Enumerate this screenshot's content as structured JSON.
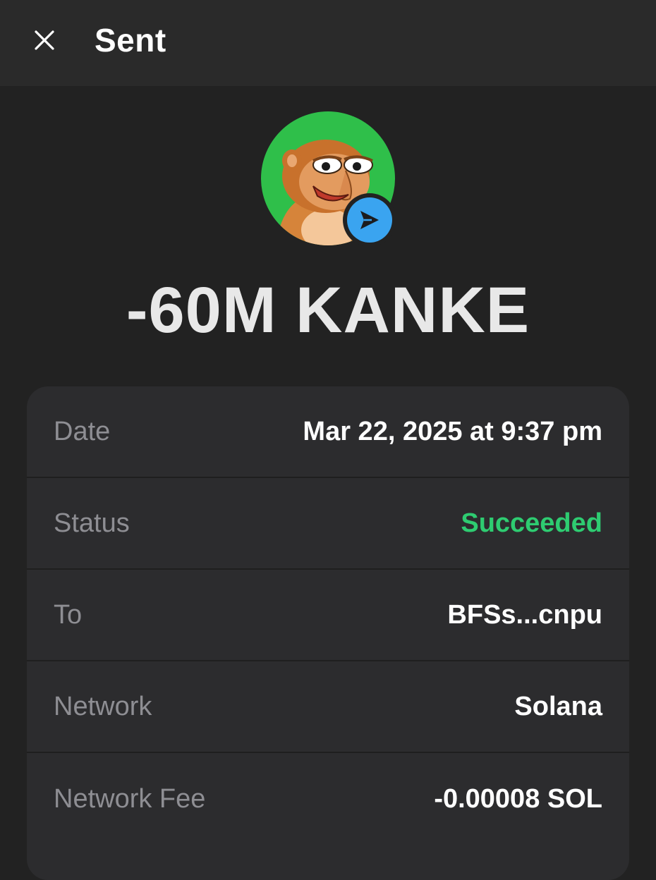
{
  "header": {
    "title": "Sent"
  },
  "transaction": {
    "amount": "-60M KANKE",
    "avatar_bg": "#2fbf4a",
    "badge_color": "#3aa4f0"
  },
  "details": {
    "rows": [
      {
        "label": "Date",
        "value": "Mar 22, 2025 at 9:37 pm"
      },
      {
        "label": "Status",
        "value": "Succeeded"
      },
      {
        "label": "To",
        "value": "BFSs...cnpu"
      },
      {
        "label": "Network",
        "value": "Solana"
      },
      {
        "label": "Network Fee",
        "value": "-0.00008 SOL"
      }
    ]
  },
  "colors": {
    "success": "#2ecc71",
    "background": "#222222",
    "card": "#2c2c2e"
  },
  "icons": {
    "close": "close-icon",
    "send": "send-icon"
  }
}
